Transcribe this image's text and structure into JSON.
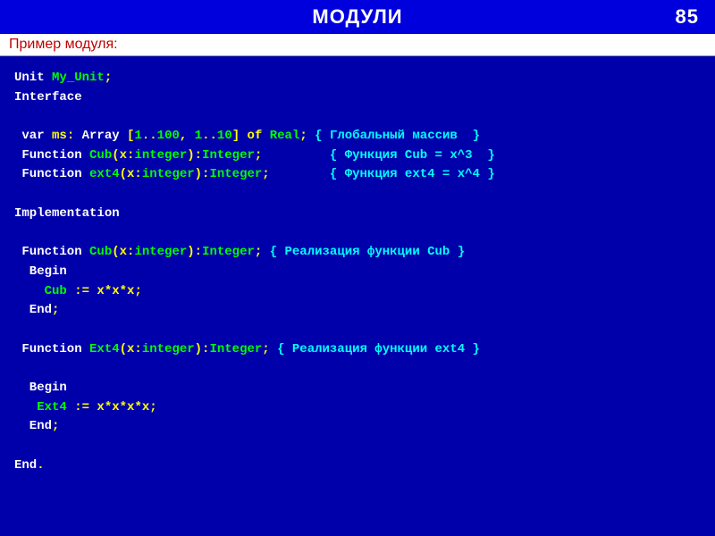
{
  "header": {
    "title": "МОДУЛИ",
    "page_number": "85"
  },
  "subtitle": "Пример модуля:",
  "code": {
    "l01": {
      "kw": "Unit ",
      "ident": "My_Unit",
      "tail": ";"
    },
    "l02": {
      "kw": "Interface"
    },
    "l03": {
      "kw": " var ",
      "t1": "ms: ",
      "kw2": "Array ",
      "t2": "[",
      "n1": "1",
      "t3": "..",
      "n2": "100",
      "t4": ", ",
      "n3": "1",
      "t5": "..",
      "n4": "10",
      "t6": "] of ",
      "type": "Real",
      "t7": "; ",
      "cmt": "{ Глобальный массив  }"
    },
    "l04": {
      "kw": " Function ",
      "ident": "Cub",
      "t1": "(x:",
      "type1": "integer",
      "t2": "):",
      "type2": "Integer",
      "t3": ";         ",
      "cmt": "{ Функция Cub = x^3  }"
    },
    "l05": {
      "kw": " Function ",
      "ident": "ext4",
      "t1": "(x:",
      "type1": "integer",
      "t2": "):",
      "type2": "Integer",
      "t3": ";        ",
      "cmt": "{ Функция ext4 = x^4 }"
    },
    "l06": {
      "kw": "Implementation"
    },
    "l07": {
      "kw": " Function ",
      "ident": "Cub",
      "t1": "(x:",
      "type1": "integer",
      "t2": "):",
      "type2": "Integer",
      "t3": "; ",
      "cmt": "{ Реализация функции Cub }"
    },
    "l08": {
      "kw": "  Begin"
    },
    "l09": {
      "t1": "    ",
      "ident": "Cub",
      "t2": " := x*x*x;"
    },
    "l10": {
      "kw": "  End",
      "t1": ";"
    },
    "l11": {
      "kw": " Function ",
      "ident": "Ext4",
      "t1": "(x:",
      "type1": "integer",
      "t2": "):",
      "type2": "Integer",
      "t3": "; ",
      "cmt": "{ Реализация функции ext4 }"
    },
    "l12": {
      "kw": "  Begin"
    },
    "l13": {
      "t1": "   ",
      "ident": "Ext4",
      "t2": " := x*x*x*x;"
    },
    "l14": {
      "kw": "  End",
      "t1": ";"
    },
    "l15": {
      "kw": "End",
      "t1": "."
    }
  }
}
